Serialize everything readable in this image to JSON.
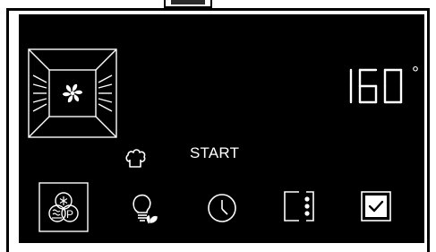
{
  "display": {
    "temperature": "160",
    "unit_symbol": "°",
    "start_label": "START"
  },
  "icons": {
    "oven_mode": "oven-fan-heating-icon",
    "chef": "chef-hat-icon",
    "special": "special-functions-icon",
    "light": "oven-light-icon",
    "timer": "clock-icon",
    "options": "menu-options-icon",
    "confirm": "checkbox-confirm-icon"
  },
  "colors": {
    "panel": "#000000",
    "foreground": "#ffffff"
  }
}
